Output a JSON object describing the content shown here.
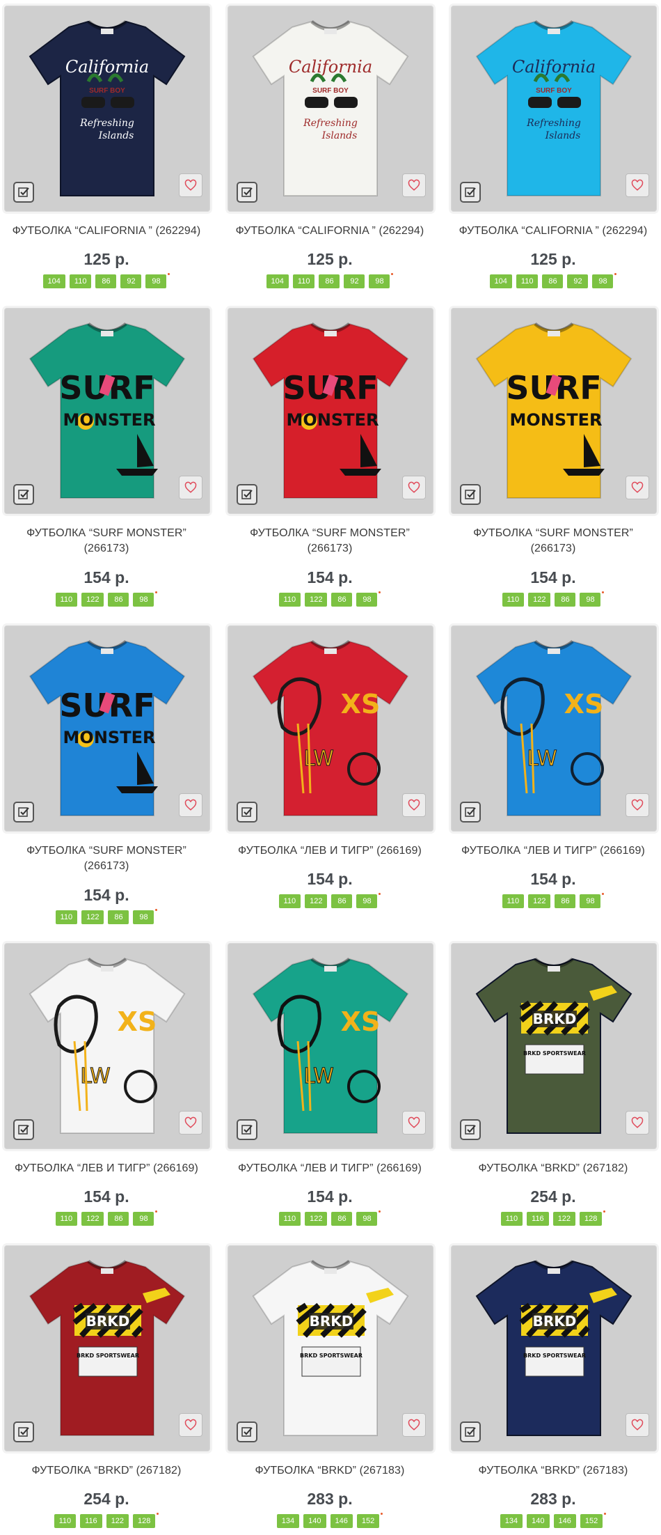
{
  "products": [
    {
      "title": "ФУТБОЛКА “CALIFORNIA ” (262294)",
      "price": "125 р.",
      "sizes": [
        "104",
        "110",
        "86",
        "92",
        "98"
      ],
      "shirt_color": "#1c2545",
      "print": "california",
      "print_color": "#ffffff"
    },
    {
      "title": "ФУТБОЛКА “CALIFORNIA ” (262294)",
      "price": "125 р.",
      "sizes": [
        "104",
        "110",
        "86",
        "92",
        "98"
      ],
      "shirt_color": "#f4f4f0",
      "print": "california",
      "print_color": "#9e2a2a"
    },
    {
      "title": "ФУТБОЛКА “CALIFORNIA ” (262294)",
      "price": "125 р.",
      "sizes": [
        "104",
        "110",
        "86",
        "92",
        "98"
      ],
      "shirt_color": "#1fb6e8",
      "print": "california",
      "print_color": "#1c2a55"
    },
    {
      "title": "ФУТБОЛКА “SURF MONSTER” (266173)",
      "price": "154 р.",
      "sizes": [
        "110",
        "122",
        "86",
        "98"
      ],
      "shirt_color": "#169b7e",
      "print": "surf",
      "print_color": "#111111"
    },
    {
      "title": "ФУТБОЛКА “SURF MONSTER” (266173)",
      "price": "154 р.",
      "sizes": [
        "110",
        "122",
        "86",
        "98"
      ],
      "shirt_color": "#d61f2a",
      "print": "surf",
      "print_color": "#111111"
    },
    {
      "title": "ФУТБОЛКА “SURF MONSTER” (266173)",
      "price": "154 р.",
      "sizes": [
        "110",
        "122",
        "86",
        "98"
      ],
      "shirt_color": "#f5bd16",
      "print": "surf",
      "print_color": "#111111"
    },
    {
      "title": "ФУТБОЛКА “SURF MONSTER” (266173)",
      "price": "154 р.",
      "sizes": [
        "110",
        "122",
        "86",
        "98"
      ],
      "shirt_color": "#1f84d6",
      "print": "surf",
      "print_color": "#111111"
    },
    {
      "title": "ФУТБОЛКА “ЛЕВ И ТИГР” (266169)",
      "price": "154 р.",
      "sizes": [
        "110",
        "122",
        "86",
        "98"
      ],
      "shirt_color": "#d42030",
      "print": "lion",
      "print_color": "#1a1a1a"
    },
    {
      "title": "ФУТБОЛКА “ЛЕВ И ТИГР” (266169)",
      "price": "154 р.",
      "sizes": [
        "110",
        "122",
        "86",
        "98"
      ],
      "shirt_color": "#1e88d8",
      "print": "lion",
      "print_color": "#102030"
    },
    {
      "title": "ФУТБОЛКА “ЛЕВ И ТИГР” (266169)",
      "price": "154 р.",
      "sizes": [
        "110",
        "122",
        "86",
        "98"
      ],
      "shirt_color": "#f5f5f5",
      "print": "lion",
      "print_color": "#1a1a1a"
    },
    {
      "title": "ФУТБОЛКА “ЛЕВ И ТИГР” (266169)",
      "price": "154 р.",
      "sizes": [
        "110",
        "122",
        "86",
        "98"
      ],
      "shirt_color": "#17a38a",
      "print": "lion",
      "print_color": "#111111"
    },
    {
      "title": "ФУТБОЛКА “BRKD” (267182)",
      "price": "254 р.",
      "sizes": [
        "110",
        "116",
        "122",
        "128"
      ],
      "shirt_color": "#4a5a3a",
      "print": "brkd",
      "print_color": "#111111"
    },
    {
      "title": "ФУТБОЛКА “BRKD” (267182)",
      "price": "254 р.",
      "sizes": [
        "110",
        "116",
        "122",
        "128"
      ],
      "shirt_color": "#a01c22",
      "print": "brkd",
      "print_color": "#111111"
    },
    {
      "title": "ФУТБОЛКА “BRKD” (267183)",
      "price": "283 р.",
      "sizes": [
        "134",
        "140",
        "146",
        "152"
      ],
      "shirt_color": "#f6f6f6",
      "print": "brkd",
      "print_color": "#111111"
    },
    {
      "title": "ФУТБОЛКА “BRKD” (267183)",
      "price": "283 р.",
      "sizes": [
        "134",
        "140",
        "146",
        "152"
      ],
      "shirt_color": "#1c2b5c",
      "print": "brkd",
      "print_color": "#111111"
    }
  ],
  "print_text": {
    "california": [
      "California",
      "SURF BOY",
      "Refreshing",
      "Islands"
    ],
    "surf": [
      "SURF",
      "MONSTER"
    ],
    "lion": [
      "XS",
      "LW"
    ],
    "brkd": [
      "BRKD",
      "BRKD SPORTSWEAR"
    ]
  },
  "icons": {
    "compare": "checkbox-compare-icon",
    "favorite": "heart-icon"
  },
  "colors": {
    "size_tag": "#7cc242",
    "size_dot": "#e85b2a",
    "price": "#474b50",
    "heart": "#e04a5a"
  }
}
